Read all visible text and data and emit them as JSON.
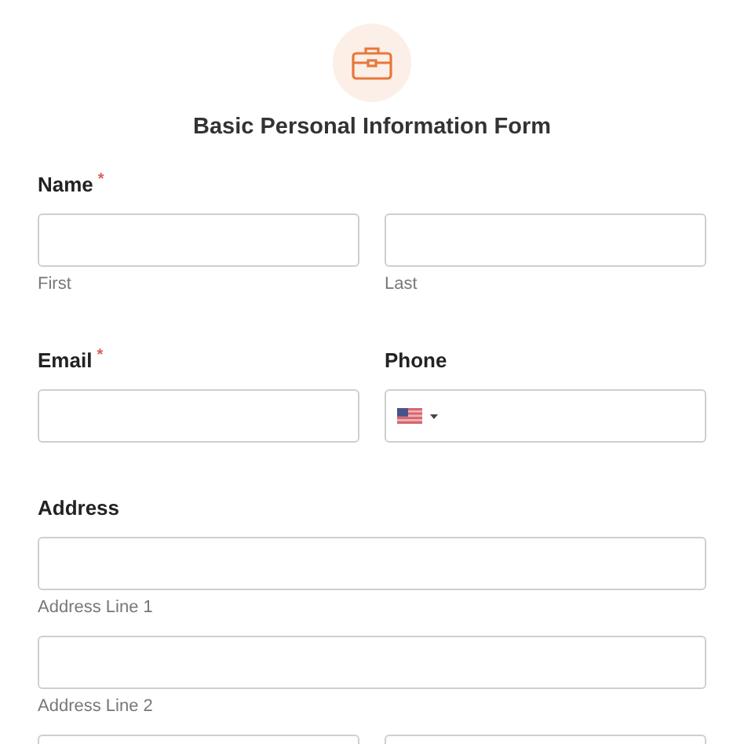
{
  "title": "Basic Personal Information Form",
  "rows": [
    {
      "label": "Name",
      "required_mark": "*",
      "inputs": [
        {
          "kind": "text",
          "sublabel": "First"
        },
        {
          "kind": "text",
          "sublabel": "Last"
        }
      ]
    },
    {
      "inputs": [
        {
          "kind": "text",
          "label": "Email",
          "required_mark": "*"
        },
        {
          "kind": "phone",
          "label": "Phone"
        }
      ]
    },
    {
      "label": "Address",
      "inputs": [
        {
          "kind": "text",
          "sublabel": "Address Line 1"
        }
      ]
    },
    {
      "inputs": [
        {
          "kind": "text",
          "sublabel": "Address Line 2"
        }
      ]
    },
    {
      "inputs": [
        {
          "kind": "text"
        },
        {
          "kind": "text"
        }
      ]
    }
  ]
}
